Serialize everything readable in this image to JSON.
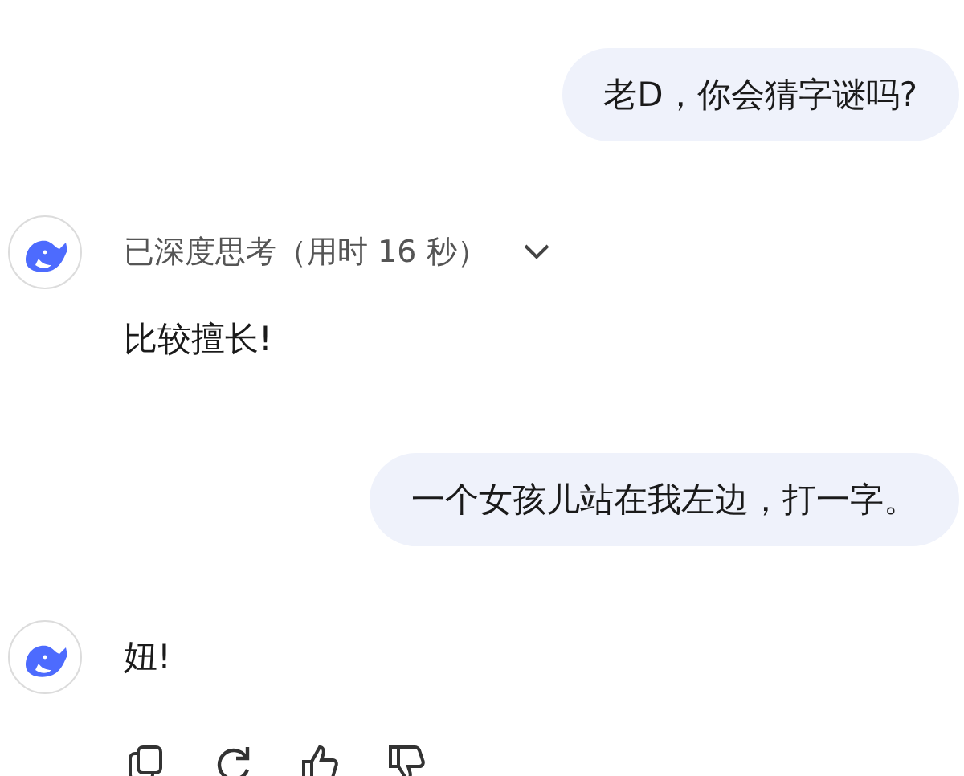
{
  "messages": [
    {
      "kind": "user",
      "text": "老D，你会猜字谜吗?"
    },
    {
      "kind": "assistant",
      "thinking": {
        "label": "已深度思考（用时 16 秒）",
        "expanded": false
      },
      "text": "比较擅长!"
    },
    {
      "kind": "user",
      "text": "一个女孩儿站在我左边，打一字。"
    },
    {
      "kind": "assistant",
      "text": "妞!",
      "actions": true
    }
  ]
}
